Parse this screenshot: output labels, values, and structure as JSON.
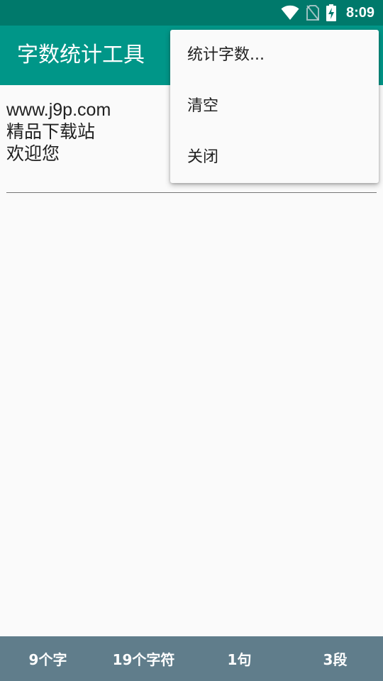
{
  "status_bar": {
    "time": "8:09",
    "icons": [
      "wifi-icon",
      "no-sim-icon",
      "battery-charging-icon"
    ]
  },
  "app_bar": {
    "title": "字数统计工具",
    "color": "#009688"
  },
  "editor": {
    "lines": [
      "www.j9p.com",
      "精品下载站",
      "欢迎您"
    ]
  },
  "menu": {
    "items": [
      {
        "label": "统计字数..."
      },
      {
        "label": "清空"
      },
      {
        "label": "关闭"
      }
    ]
  },
  "stats": {
    "chars": "9个字",
    "characters": "19个字符",
    "sentences": "1句",
    "paragraphs": "3段",
    "color": "#607d8b"
  }
}
